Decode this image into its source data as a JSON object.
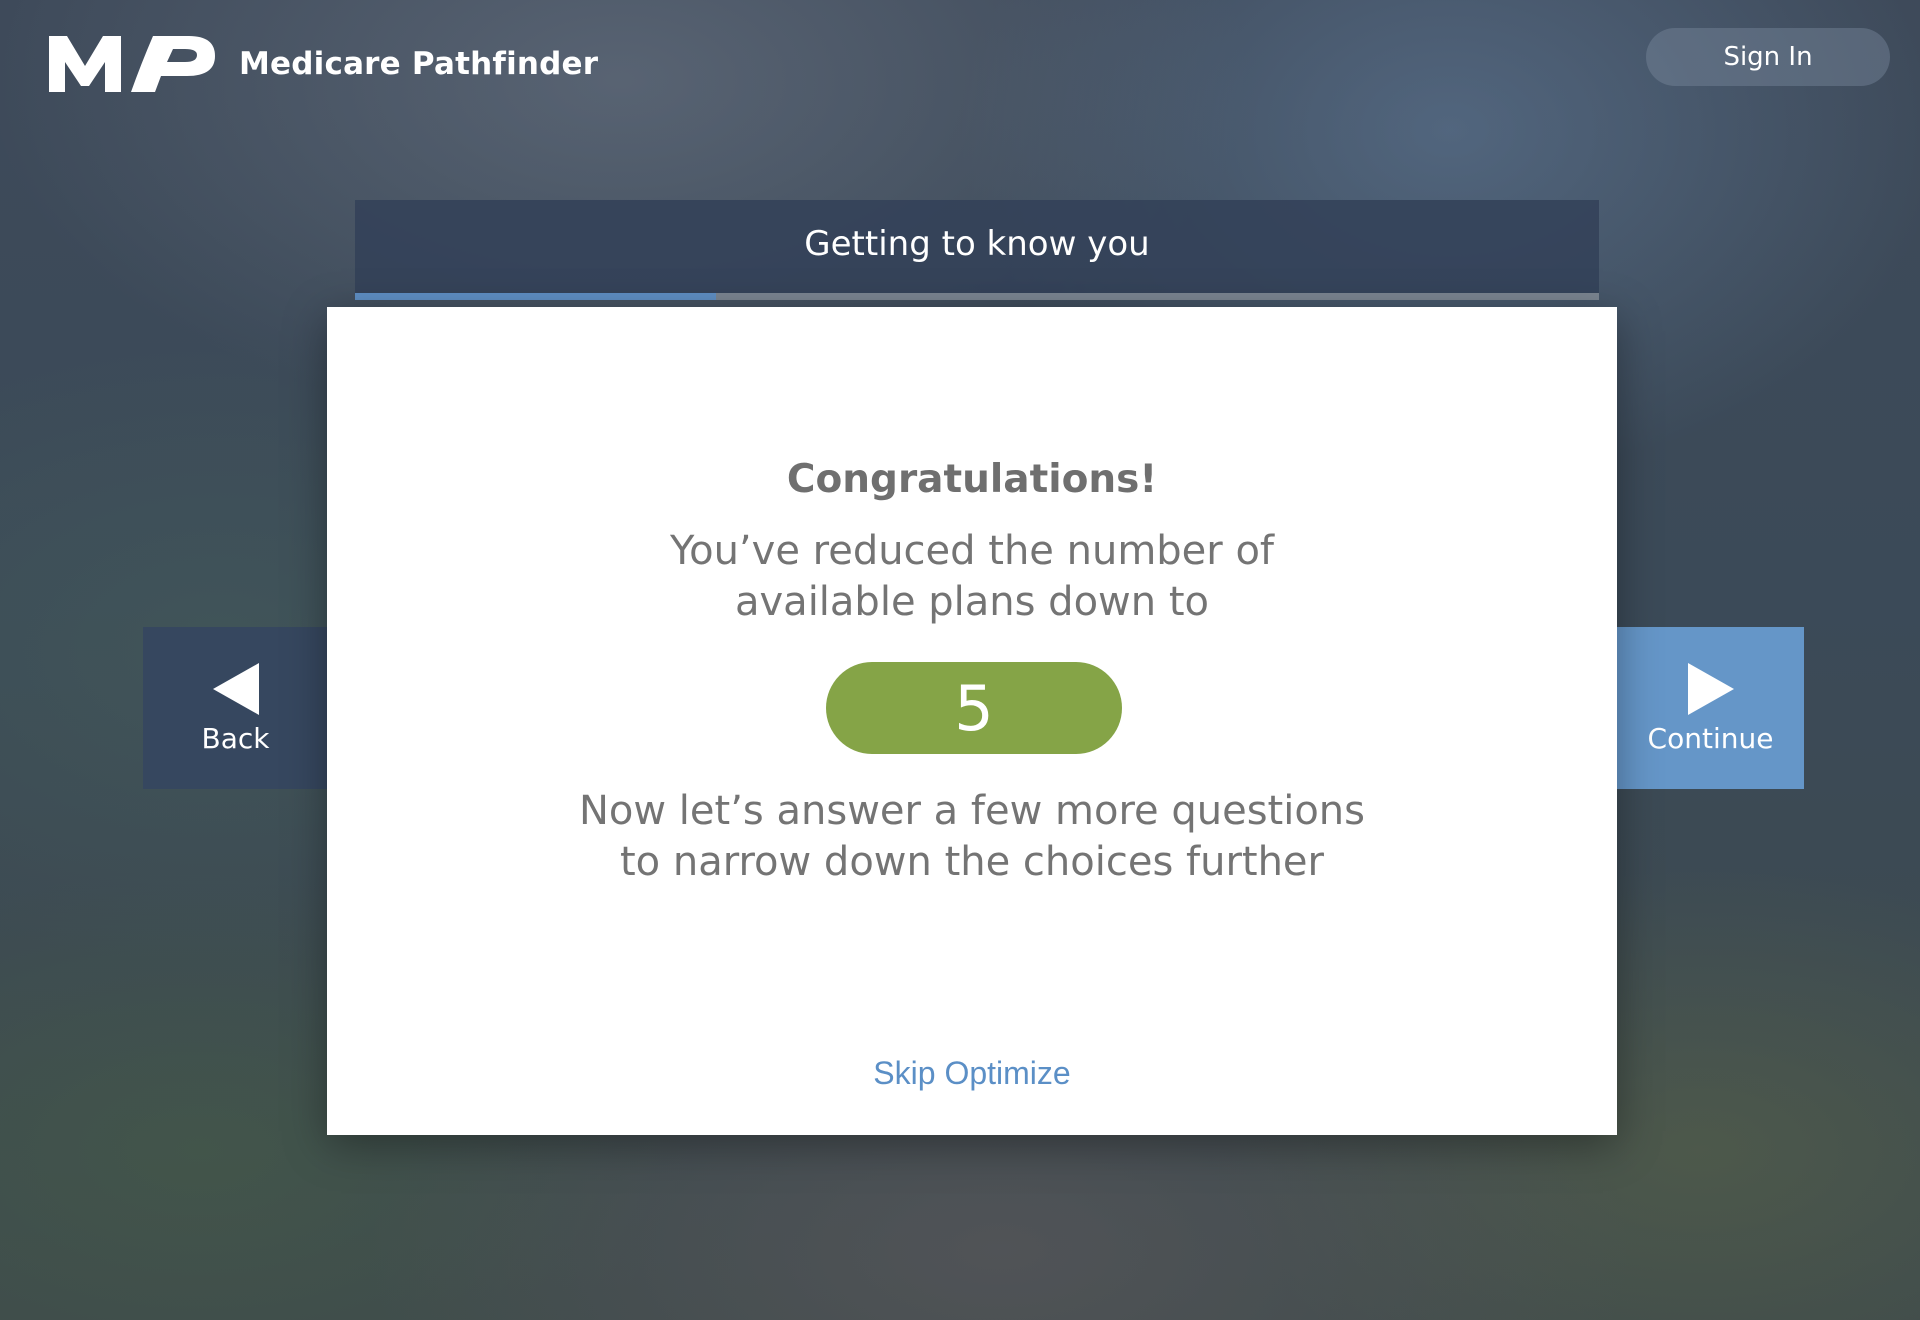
{
  "header": {
    "brand_name": "Medicare Pathfinder",
    "logo_text": "MP",
    "sign_in_label": "Sign In"
  },
  "step": {
    "title": "Getting to know you",
    "progress_fraction": 0.29
  },
  "nav": {
    "back_label": "Back",
    "continue_label": "Continue"
  },
  "card": {
    "title": "Congratulations!",
    "message_line1": "You’ve reduced the number of",
    "message_line2": "available plans down to",
    "plan_count": "5",
    "followup_line1": "Now let’s answer a few more questions",
    "followup_line2": "to narrow down the choices further",
    "skip_label": "Skip Optimize"
  },
  "colors": {
    "accent_blue": "#5f8fc4",
    "continue_blue": "#6596c8",
    "count_green": "#85a447",
    "link_blue": "#5b8fc6"
  },
  "icons": {
    "back": "triangle-left-icon",
    "continue": "triangle-right-icon",
    "logo": "mp-logo-icon"
  }
}
